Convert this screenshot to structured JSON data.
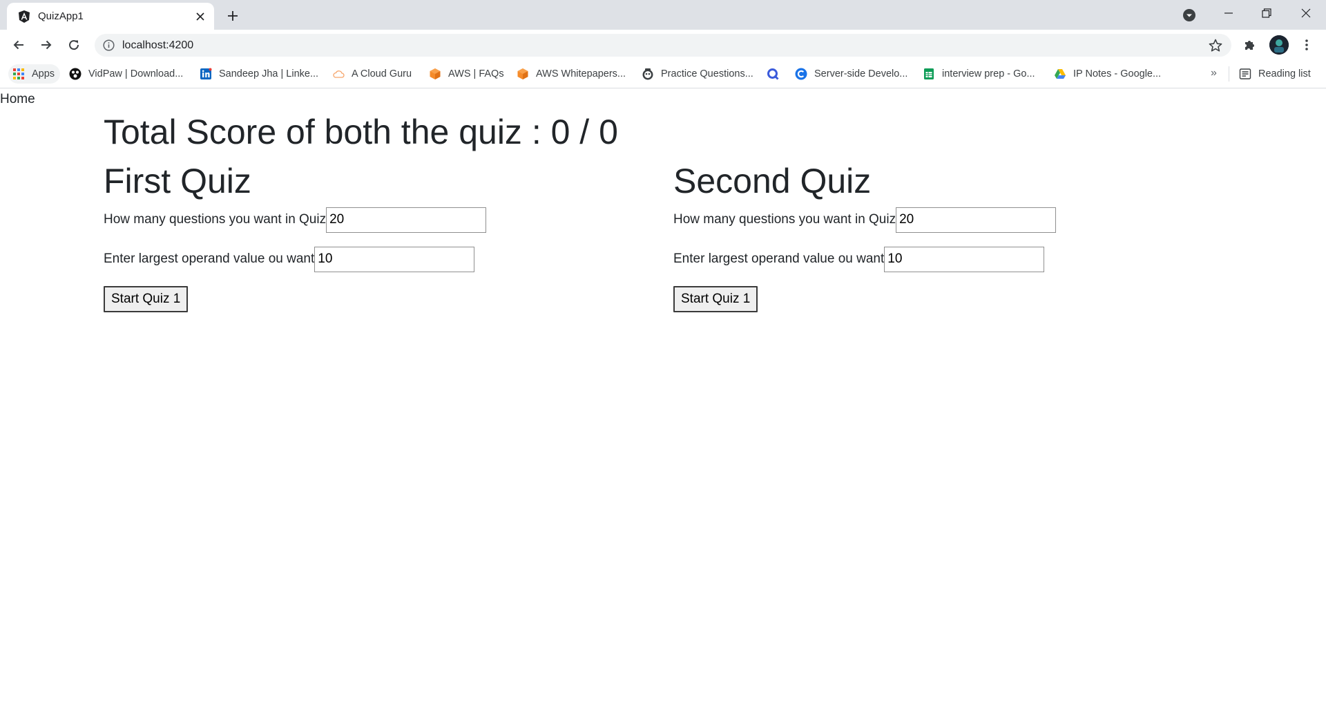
{
  "browser": {
    "tab": {
      "title": "QuizApp1",
      "favicon": "angular-icon"
    },
    "url": "localhost:4200",
    "bookmarks": [
      {
        "label": "Apps",
        "icon": "apps-grid-icon"
      },
      {
        "label": "VidPaw | Download...",
        "icon": "vidpaw-icon"
      },
      {
        "label": "Sandeep Jha | Linke...",
        "icon": "linkedin-icon"
      },
      {
        "label": "A Cloud Guru",
        "icon": "cloud-icon"
      },
      {
        "label": "AWS | FAQs",
        "icon": "aws-cube-icon"
      },
      {
        "label": "AWS Whitepapers...",
        "icon": "aws-cube-icon"
      },
      {
        "label": "Practice Questions...",
        "icon": "practice-icon"
      },
      {
        "label": "",
        "icon": "q-icon"
      },
      {
        "label": "Server-side Develo...",
        "icon": "c-icon"
      },
      {
        "label": "interview prep - Go...",
        "icon": "sheets-icon"
      },
      {
        "label": "IP Notes - Google...",
        "icon": "drive-icon"
      }
    ],
    "reading_list": "Reading list",
    "chevron": "»"
  },
  "page": {
    "home_link": "Home",
    "total_score": "Total Score of both the quiz : 0 / 0",
    "quizzes": [
      {
        "title": "First Quiz",
        "questions_label": "How many questions you want in Quiz",
        "questions_value": "20",
        "operand_label": "Enter largest operand value ou want",
        "operand_value": "10",
        "start_label": "Start Quiz 1"
      },
      {
        "title": "Second Quiz",
        "questions_label": "How many questions you want in Quiz",
        "questions_value": "20",
        "operand_label": "Enter largest operand value ou want",
        "operand_value": "10",
        "start_label": "Start Quiz 1"
      }
    ]
  },
  "colors": {
    "tabstrip": "#dee1e6",
    "omnibox": "#f1f3f4",
    "text": "#212529",
    "button_bg": "#efefef"
  }
}
